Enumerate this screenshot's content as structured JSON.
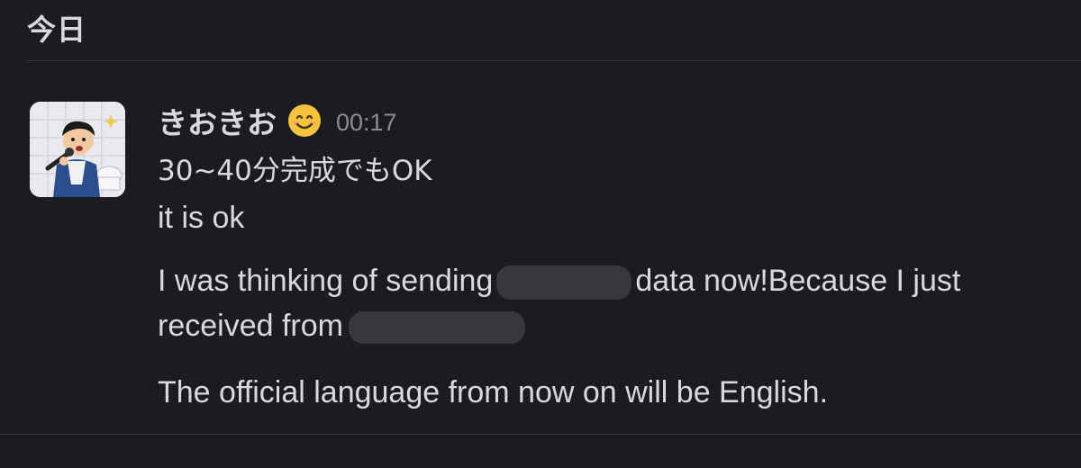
{
  "day_header": "今日",
  "message": {
    "sender": "きおきお",
    "status_emoji": "smiling-face-emoji",
    "timestamp": "00:17",
    "lines": {
      "line1": "30~40分完成でもOK",
      "line2": "it is ok",
      "line3_part1": "I was thinking of sending",
      "line3_part2": "data now!Because I just",
      "line3b_part1": "received from",
      "line4": "The official language from now on will be English."
    }
  },
  "colors": {
    "background": "#1b1c20",
    "text": "#d9d9dc",
    "timestamp": "#8c8d92",
    "divider": "#3a3b40",
    "redaction": "#36383d"
  }
}
